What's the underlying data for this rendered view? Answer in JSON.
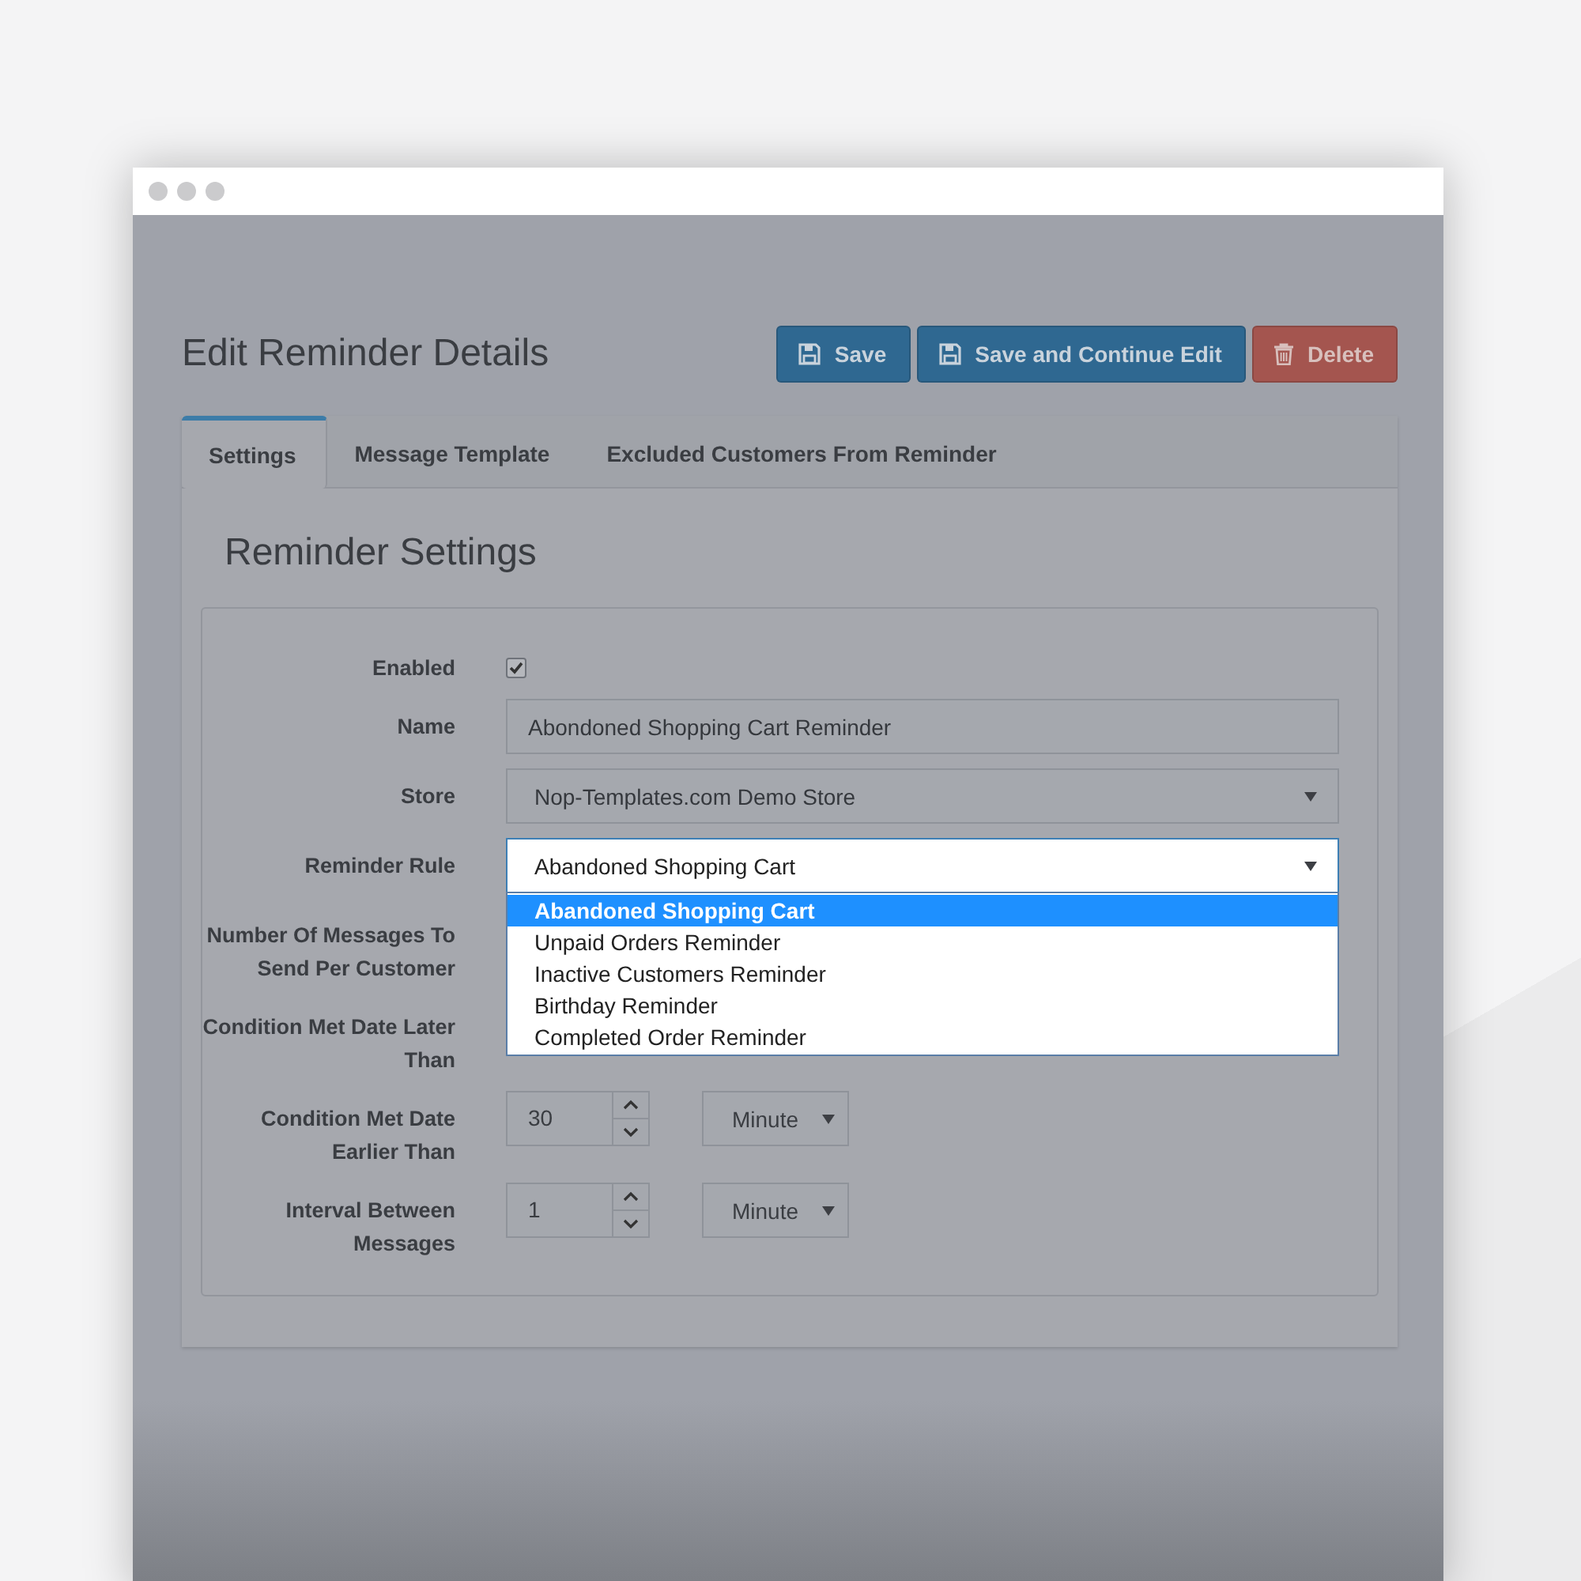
{
  "page": {
    "title": "Edit Reminder Details"
  },
  "buttons": [
    {
      "label": "Save",
      "kind": "primary"
    },
    {
      "label": "Save and Continue Edit",
      "kind": "primary"
    },
    {
      "label": "Delete",
      "kind": "danger"
    }
  ],
  "tabs": [
    {
      "label": "Settings",
      "selected": true
    },
    {
      "label": "Message Template",
      "selected": false
    },
    {
      "label": "Excluded Customers From Reminder",
      "selected": false
    }
  ],
  "section_title": "Reminder Settings",
  "form": {
    "fields": [
      {
        "label": "Enabled",
        "kind": "checkbox",
        "checked": true
      },
      {
        "label": "Name",
        "kind": "text",
        "value": "Abondoned Shopping Cart Reminder"
      },
      {
        "label": "Store",
        "kind": "select",
        "value": "Nop-Templates.com Demo Store"
      },
      {
        "label": "Reminder Rule",
        "kind": "dropdown",
        "value": "Abandoned Shopping Cart",
        "open": true,
        "options": [
          {
            "label": "Abandoned Shopping Cart",
            "selected": true
          },
          {
            "label": "Unpaid Orders Reminder",
            "selected": false
          },
          {
            "label": "Inactive Customers Reminder",
            "selected": false
          },
          {
            "label": "Birthday Reminder",
            "selected": false
          },
          {
            "label": "Completed Order Reminder",
            "selected": false
          }
        ]
      },
      {
        "label": "Number Of Messages To Send Per Customer",
        "kind": "covered"
      },
      {
        "label": "Condition Met Date Later Than",
        "kind": "covered"
      },
      {
        "label": "Condition Met Date Earlier Than",
        "kind": "duration",
        "value": "30",
        "unit": "Minute"
      },
      {
        "label": "Interval Between Messages",
        "kind": "duration",
        "value": "1",
        "unit": "Minute"
      }
    ]
  }
}
